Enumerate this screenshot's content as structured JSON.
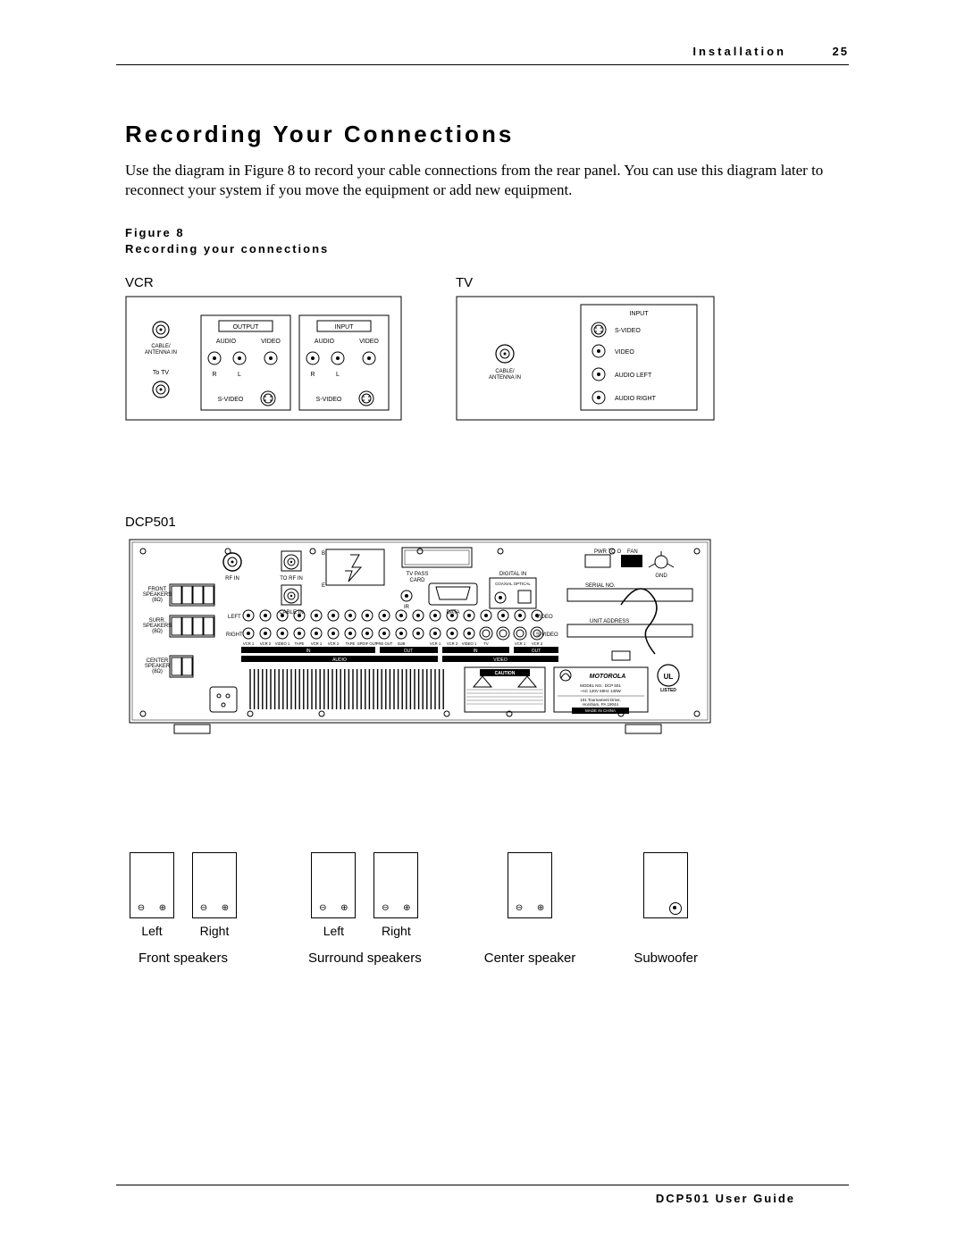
{
  "header": {
    "section": "Installation",
    "page": "25"
  },
  "title": "Recording Your Connections",
  "body": "Use the diagram in Figure 8 to record your cable connections from the rear panel. You can use this diagram later to reconnect your system if you move the equipment or add new equipment.",
  "figure": {
    "num": "Figure 8",
    "caption": "Recording your connections"
  },
  "devices": {
    "vcr": {
      "label": "VCR",
      "ant_in": "CABLE/\nANTENNA IN",
      "to_tv": "To TV",
      "output": "OUTPUT",
      "input": "INPUT",
      "audio": "AUDIO",
      "video": "VIDEO",
      "r": "R",
      "l": "L",
      "svideo": "S-VIDEO"
    },
    "tv": {
      "label": "TV",
      "ant_in": "CABLE/\nANTENNA IN",
      "input": "INPUT",
      "svideo": "S-VIDEO",
      "video": "VIDEO",
      "audio_l": "AUDIO LEFT",
      "audio_r": "AUDIO RIGHT"
    },
    "dcp": {
      "label": "DCP501",
      "rf_in": "RF IN",
      "to_rf_in": "TO RF IN",
      "cable_in": "CABLE IN",
      "tv_pass": "TV PASS\nCARD",
      "ir": "IR",
      "data": "DATA",
      "digital_in": "DIGITAL IN",
      "optical": "COAXIAL OPTICAL",
      "serial_no": "SERIAL NO.",
      "unit_addr": "UNIT ADDRESS",
      "pwr": "PWR TO O",
      "fan": "FAN",
      "gnd": "GND",
      "front": "FRONT\nSPEAKERS\n(8Ω)",
      "surr": "SURR.\nSPEAKERS\n(8Ω)",
      "center": "CENTER\nSPEAKER\n(8Ω)",
      "left": "LEFT",
      "right": "RIGHT",
      "video_row": "VIDEO",
      "svideo": "S-VIDEO",
      "in": "IN",
      "out": "OUT",
      "audio": "AUDIO",
      "video_lbl": "VIDEO",
      "cols": [
        "VCR 1",
        "VCR 2",
        "VIDEO 1",
        "TAPE",
        "VCR 1",
        "VCR 2",
        "TAPE",
        "SPDIF OUT",
        "PRE OUT",
        "SUB",
        "",
        "VCR 1",
        "VCR 2",
        "VIDEO 1",
        "TV",
        "",
        "VCR 1",
        "VCR 2"
      ],
      "brand": "MOTOROLA",
      "ul": "UL\nLISTED",
      "model": "MODEL NO.: DCP 501",
      "power": "~AC 120V 60Hz   140W",
      "addr": "101 Tournament Drive,\nHorsham, PA 19044",
      "made": "MADE IN CHINA",
      "caution": "CAUTION"
    }
  },
  "speakers": {
    "left": "Left",
    "right": "Right",
    "front": "Front speakers",
    "surround": "Surround speakers",
    "center": "Center speaker",
    "sub": "Subwoofer",
    "minus": "⊖",
    "plus": "⊕"
  },
  "footer": "DCP501 User Guide"
}
